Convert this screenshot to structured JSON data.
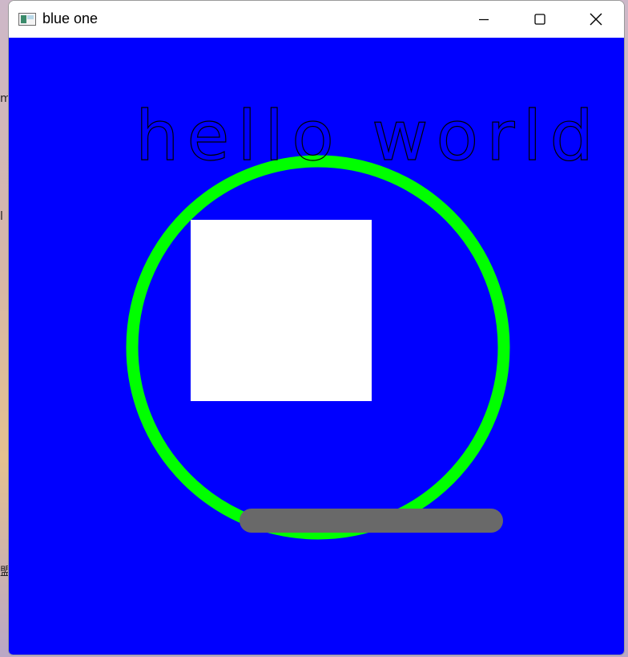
{
  "window": {
    "title": "blue one",
    "icon": "app-window-icon"
  },
  "controls": {
    "minimize_icon": "minimize-icon",
    "maximize_icon": "maximize-icon",
    "close_icon": "close-icon"
  },
  "canvas": {
    "background_color": "#0000ff",
    "text": "hello world",
    "text_color": "#000000",
    "circle_color": "#00ff00",
    "rect_color": "#ffffff",
    "line_color": "#696969"
  },
  "desktop": {
    "glyph_1": "m",
    "glyph_2": "l",
    "glyph_3": "盟"
  }
}
